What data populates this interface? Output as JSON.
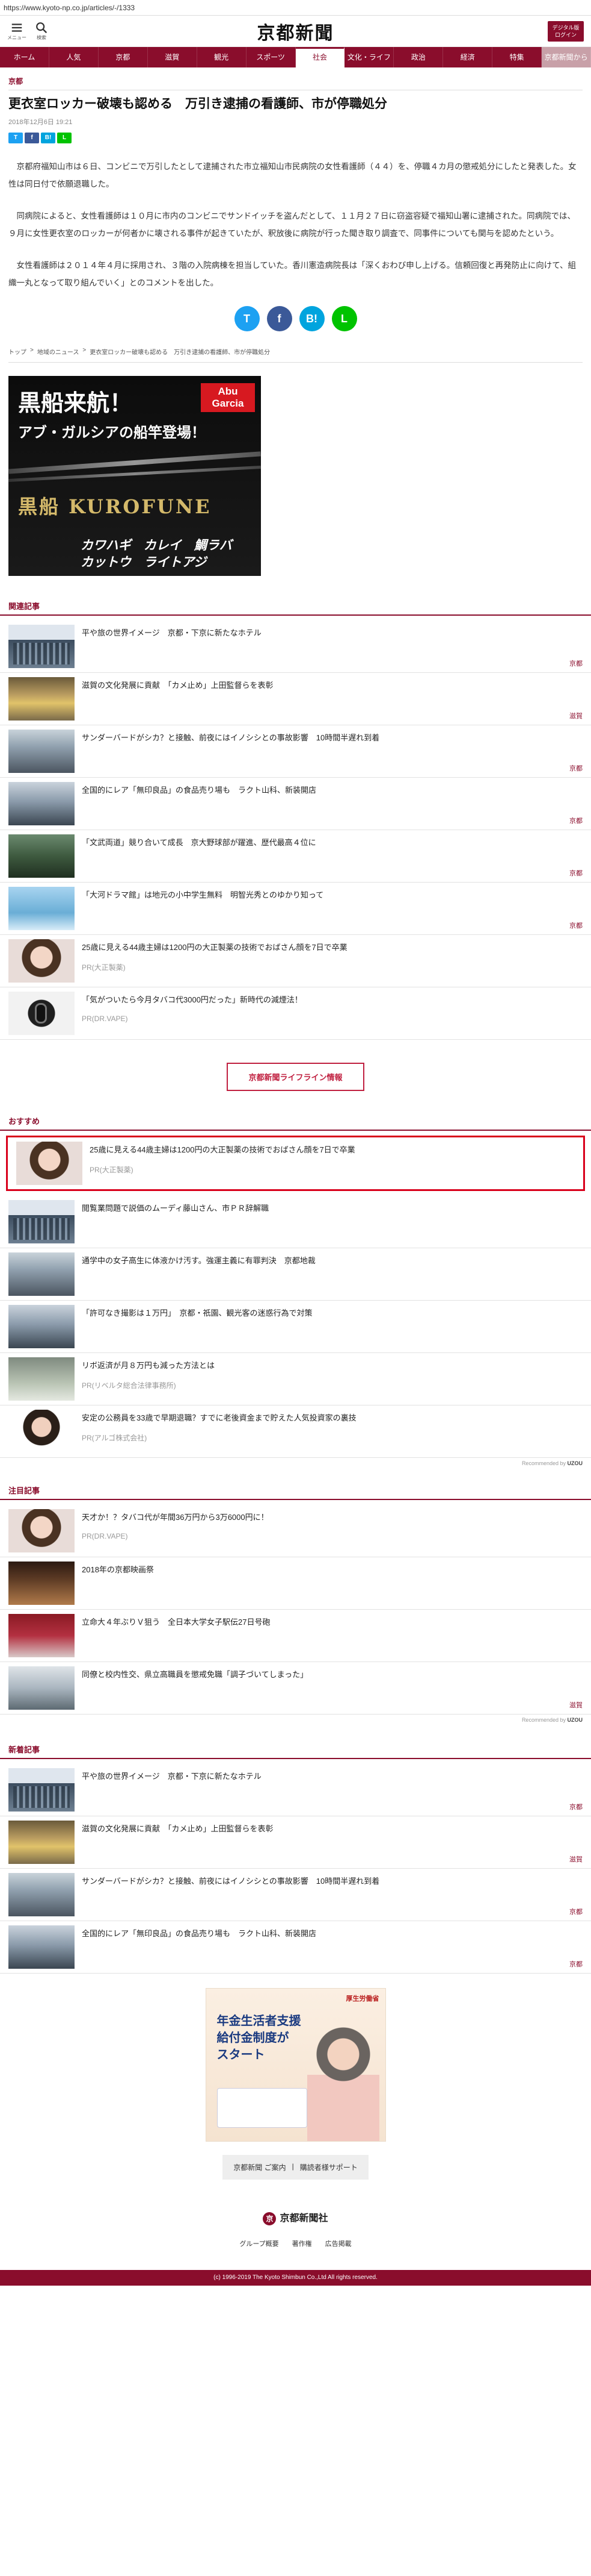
{
  "url": "https://www.kyoto-np.co.jp/articles/-/1333",
  "header": {
    "menu_label": "メニュー",
    "search_label": "検索",
    "logo": "京都新聞",
    "digital_label": "デジタル版\nログイン"
  },
  "nav": [
    {
      "label": "ホーム"
    },
    {
      "label": "人気"
    },
    {
      "label": "京都"
    },
    {
      "label": "滋賀"
    },
    {
      "label": "観光"
    },
    {
      "label": "スポーツ"
    },
    {
      "label": "社会",
      "active": true
    },
    {
      "label": "文化・ライフ"
    },
    {
      "label": "政治"
    },
    {
      "label": "経済"
    },
    {
      "label": "特集"
    },
    {
      "label": "京都新聞から",
      "sub": true
    }
  ],
  "article": {
    "category": "京都",
    "title": "更衣室ロッカー破壊も認める　万引き逮捕の看護師、市が停職処分",
    "date": "2018年12月6日 19:21",
    "share": [
      "T",
      "f",
      "B!",
      "L"
    ],
    "paragraphs": [
      "京都府福知山市は６日、コンビニで万引したとして逮捕された市立福知山市民病院の女性看護師（４４）を、停職４カ月の懲戒処分にしたと発表した。女性は同日付で依願退職した。",
      "同病院によると、女性看護師は１０月に市内のコンビニでサンドイッチを盗んだとして、１１月２７日に窃盗容疑で福知山署に逮捕された。同病院では、９月に女性更衣室のロッカーが何者かに壊される事件が起きていたが、釈放後に病院が行った聞き取り調査で、同事件についても関与を認めたという。",
      "女性看護師は２０１４年４月に採用され、３階の入院病棟を担当していた。香川憲造病院長は「深くおわび申し上げる。信頼回復と再発防止に向けて、組織一丸となって取り組んでいく」とのコメントを出した。"
    ],
    "share_round": [
      "T",
      "f",
      "B!",
      "L"
    ],
    "breadcrumb": [
      "トップ",
      "地域のニュース",
      "更衣室ロッカー破壊も認める　万引き逮捕の看護師、市が停職処分"
    ]
  },
  "ad1": {
    "line1": "黒船来航！",
    "line2": "アブ・ガルシアの船竿登場！",
    "logo": "Abu Garcia",
    "brand": "黒船 KUROFUNE",
    "sub1": "カワハギ　カレイ　鯛ラバ",
    "sub2": "カットウ　ライトアジ"
  },
  "related": {
    "heading": "関連記事",
    "items": [
      {
        "title": "平や旅の世界イメージ　京都・下京に新たなホテル",
        "meta": "京都",
        "thumb": "building"
      },
      {
        "title": "滋賀の文化発展に貢献　「カメ止め」上田監督らを表彰",
        "meta": "滋賀",
        "thumb": "group"
      },
      {
        "title": "サンダーバードがシカ？と接触、前夜にはイノシシとの事故影響　10時間半遅れ到着",
        "meta": "京都",
        "thumb": "bike"
      },
      {
        "title": "全国的にレア「無印良品」の食品売り場も　ラクト山科、新装開店",
        "meta": "京都",
        "thumb": "street"
      },
      {
        "title": "「文武両道」競り合いて成長　京大野球部が躍進、歴代最高４位に",
        "meta": "京都",
        "thumb": "team"
      },
      {
        "title": "「大河ドラマ館」は地元の小中学生無料　明智光秀とのゆかり知って",
        "meta": "京都",
        "thumb": "kyoto"
      },
      {
        "title": "25歳に見える44歳主婦は1200円の大正製薬の技術でおばさん顔を7日で卒業",
        "pr": "PR(大正製薬)",
        "thumb": "face"
      },
      {
        "title": "「気がついたら今月タバコ代3000円だった」新時代の減煙法！",
        "pr": "PR(DR.VAPE)",
        "thumb": "dark"
      }
    ]
  },
  "lifeline_label": "京都新聞ライフライン情報",
  "recommend": {
    "heading": "おすすめ",
    "items": [
      {
        "title": "25歳に見える44歳主婦は1200円の大正製薬の技術でおばさん顔を7日で卒業",
        "pr": "PR(大正製薬)",
        "thumb": "face",
        "highlight": true
      },
      {
        "title": "閲覧業問題で説価のムーディ藤山さん、市ＰＲ辞解職",
        "thumb": "building"
      },
      {
        "title": "通学中の女子高生に体液かけ汚す。強運主義に有罪判決　京都地裁",
        "thumb": "bike"
      },
      {
        "title": "「許可なき撮影は１万円」　京都・祇園、観光客の迷惑行為で対策",
        "thumb": "street"
      },
      {
        "title": "リボ返済が月８万円も減った方法とは",
        "pr": "PR(リベルタ総合法律事務所)",
        "thumb": "money"
      },
      {
        "title": "安定の公務員を33歳で早期退職？すでに老後資金まで貯えた人気投資家の裏技",
        "pr": "PR(アルゴ株式会社)",
        "thumb": "woman2"
      }
    ],
    "recommended_by": "Recommended by",
    "recommended_brand": "UZOU"
  },
  "attention": {
    "heading": "注目記事",
    "items": [
      {
        "title": "天才か！？タバコ代が年間36万円から3万6000円に！",
        "pr": "PR(DR.VAPE)",
        "thumb": "face"
      },
      {
        "title": "2018年の京都映画祭",
        "thumb": "crowd"
      },
      {
        "title": "立命大４年ぶりＶ狙う　全日本大学女子駅伝27日号砲",
        "thumb": "runners"
      },
      {
        "title": "同僚と校内性交、県立高職員を懲戒免職「調子づいてしまった」",
        "meta": "滋賀",
        "thumb": "school"
      }
    ],
    "recommended_by": "Recommended by",
    "recommended_brand": "UZOU"
  },
  "latest": {
    "heading": "新着記事",
    "items": [
      {
        "title": "平や旅の世界イメージ　京都・下京に新たなホテル",
        "meta": "京都",
        "thumb": "building"
      },
      {
        "title": "滋賀の文化発展に貢献　「カメ止め」上田監督らを表彰",
        "meta": "滋賀",
        "thumb": "group"
      },
      {
        "title": "サンダーバードがシカ？と接触、前夜にはイノシシとの事故影響　10時間半遅れ到着",
        "meta": "京都",
        "thumb": "bike"
      },
      {
        "title": "全国的にレア「無印良品」の食品売り場も　ラクト山科、新装開店",
        "meta": "京都",
        "thumb": "street"
      }
    ]
  },
  "ad2": {
    "badge": "厚生労働省",
    "lines": [
      "年金生活者支援",
      "給付金制度が",
      "スタート"
    ]
  },
  "footer": {
    "links": [
      "京都新聞 ご案内",
      "|",
      "購読者様サポート"
    ],
    "logo": "京都新聞社",
    "logo_mark": "京",
    "sub_links": [
      "グループ概要",
      "著作権",
      "広告掲載"
    ],
    "copyright": "(c) 1996-2019 The Kyoto Shimbun Co.,Ltd All rights reserved."
  }
}
